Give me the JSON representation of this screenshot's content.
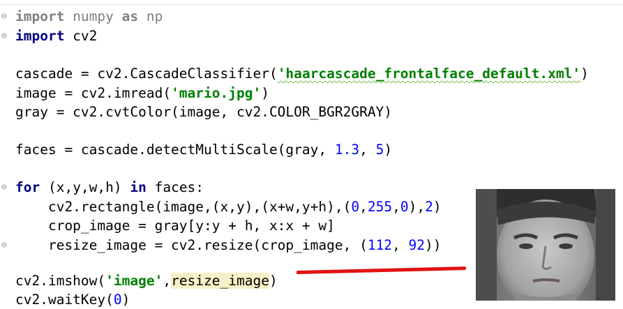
{
  "lines": [
    {
      "parts": [
        {
          "t": "import",
          "c": "kw dim"
        },
        {
          "t": " numpy ",
          "c": "dim"
        },
        {
          "t": "as",
          "c": "kw dim"
        },
        {
          "t": " np",
          "c": "dim"
        }
      ]
    },
    {
      "parts": [
        {
          "t": "import",
          "c": "kw"
        },
        {
          "t": " cv2",
          "c": ""
        }
      ]
    },
    {
      "parts": [
        {
          "t": "cascade = cv2.CascadeClassifier(",
          "c": ""
        },
        {
          "t": "'haarcascade_frontalface_default.xml'",
          "c": "str squig"
        },
        {
          "t": ")",
          "c": ""
        }
      ]
    },
    {
      "parts": [
        {
          "t": "image = cv2.imread(",
          "c": ""
        },
        {
          "t": "'mario.jpg'",
          "c": "str"
        },
        {
          "t": ")",
          "c": ""
        }
      ]
    },
    {
      "parts": [
        {
          "t": "gray = cv2.cvtColor(image, cv2.COLOR_BGR2GRAY)",
          "c": ""
        }
      ]
    },
    {
      "parts": [
        {
          "t": "faces = cascade.detectMultiScale(gray, ",
          "c": ""
        },
        {
          "t": "1.3",
          "c": "num"
        },
        {
          "t": ", ",
          "c": ""
        },
        {
          "t": "5",
          "c": "num"
        },
        {
          "t": ")",
          "c": ""
        }
      ]
    },
    {
      "parts": [
        {
          "t": "for",
          "c": "kw"
        },
        {
          "t": " (x,y,w,h) ",
          "c": ""
        },
        {
          "t": "in",
          "c": "kw"
        },
        {
          "t": " faces:",
          "c": ""
        }
      ]
    },
    {
      "parts": [
        {
          "t": "    cv2.rectangle(image,(x,y),(x+w,y+h),(",
          "c": ""
        },
        {
          "t": "0",
          "c": "num"
        },
        {
          "t": ",",
          "c": ""
        },
        {
          "t": "255",
          "c": "num"
        },
        {
          "t": ",",
          "c": ""
        },
        {
          "t": "0",
          "c": "num"
        },
        {
          "t": "),",
          "c": ""
        },
        {
          "t": "2",
          "c": "num"
        },
        {
          "t": ")",
          "c": ""
        }
      ]
    },
    {
      "parts": [
        {
          "t": "    crop_image = gray[y:y + h, x:x + w]",
          "c": ""
        }
      ]
    },
    {
      "parts": [
        {
          "t": "    resize_image = cv2.resize(crop_image, (",
          "c": ""
        },
        {
          "t": "112",
          "c": "num"
        },
        {
          "t": ", ",
          "c": ""
        },
        {
          "t": "92",
          "c": "num"
        },
        {
          "t": "))",
          "c": ""
        }
      ]
    },
    {
      "parts": [
        {
          "t": "cv2.imshow(",
          "c": ""
        },
        {
          "t": "'image'",
          "c": "str"
        },
        {
          "t": ",",
          "c": ""
        },
        {
          "t": "resize_image",
          "c": "hl"
        },
        {
          "t": ")",
          "c": ""
        }
      ]
    },
    {
      "parts": [
        {
          "t": "cv2.waitKey(",
          "c": ""
        },
        {
          "t": "0",
          "c": "num"
        },
        {
          "t": ")",
          "c": ""
        }
      ]
    }
  ],
  "colors": {
    "keyword": "#000080",
    "string": "#008000",
    "number": "#0000ff",
    "highlight": "#f7f0c6",
    "annotation_arrow": "#e31212"
  },
  "icons": {
    "fold_markers": "fold-marker-icon",
    "photo": "face-photo"
  }
}
